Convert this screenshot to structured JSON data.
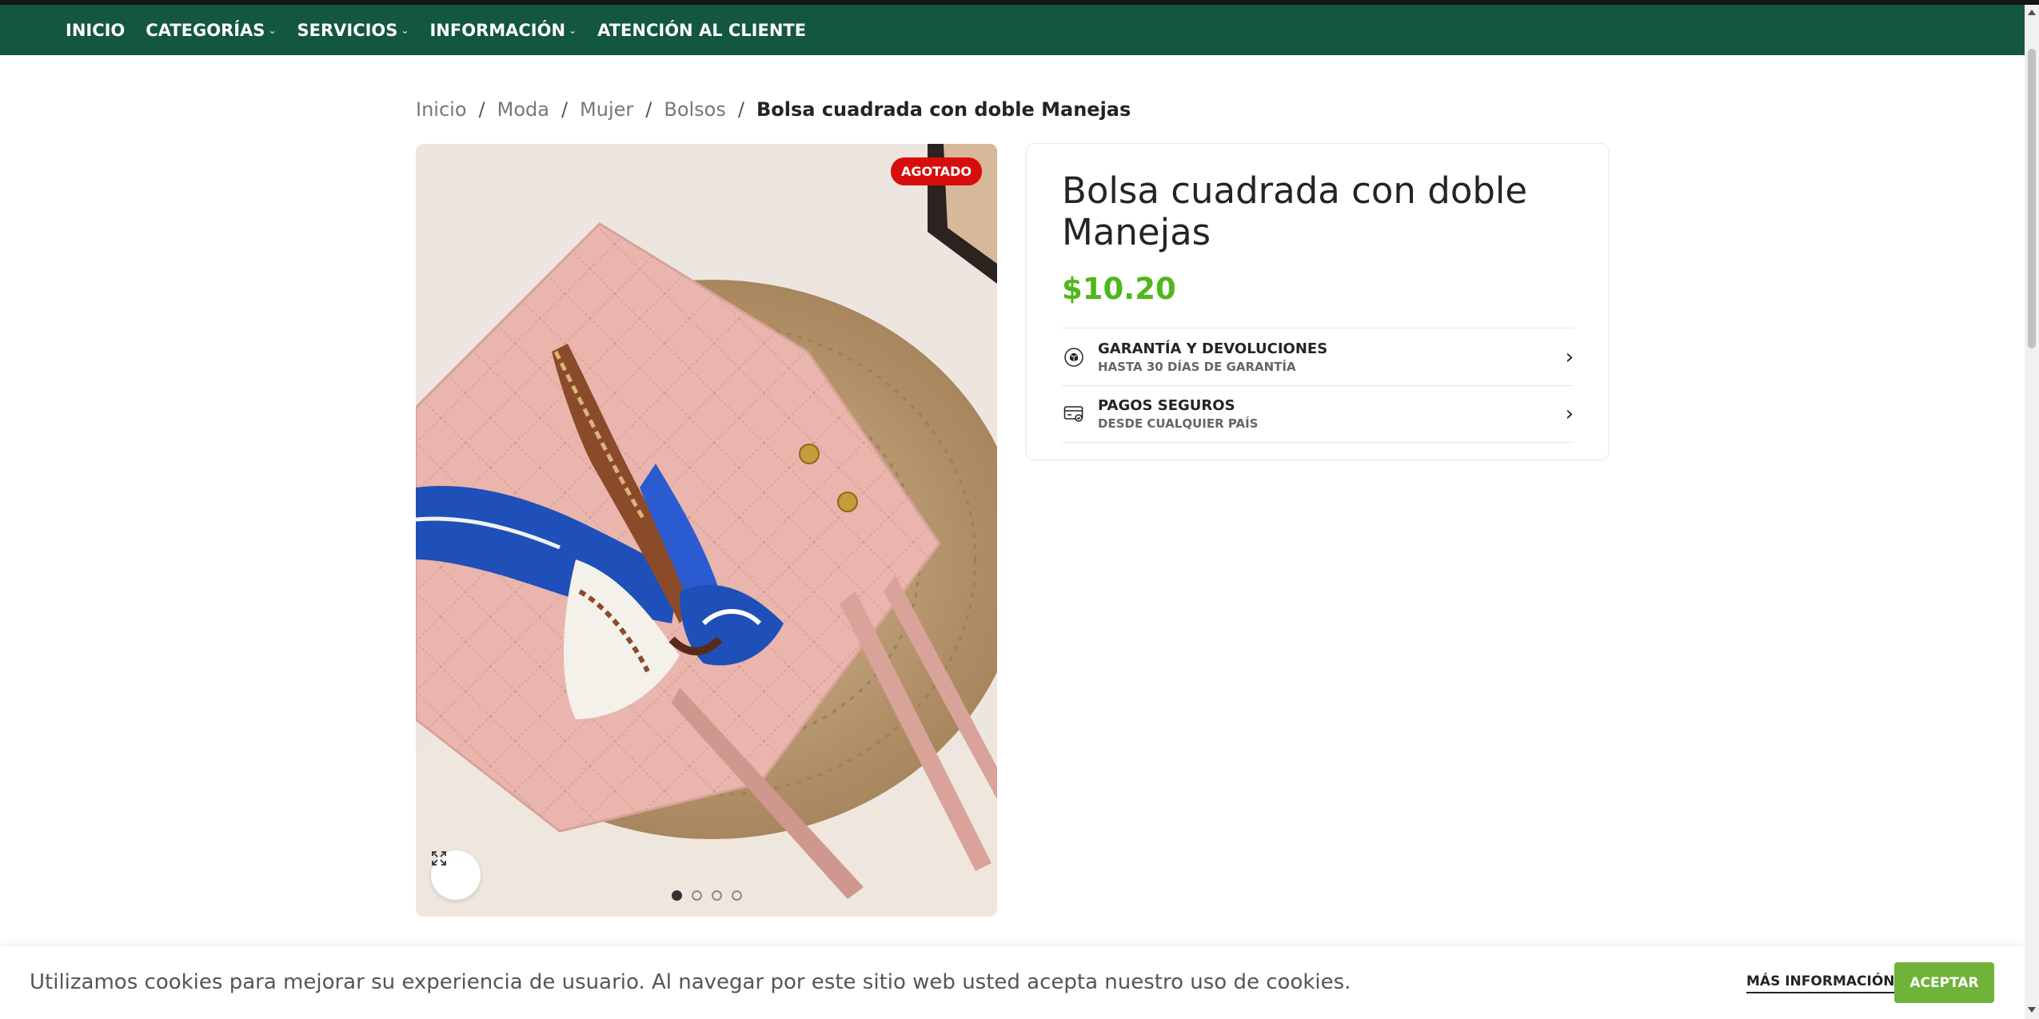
{
  "nav": {
    "items": [
      {
        "label": "INICIO",
        "has_dropdown": false
      },
      {
        "label": "CATEGORÍAS",
        "has_dropdown": true
      },
      {
        "label": "SERVICIOS",
        "has_dropdown": true
      },
      {
        "label": "INFORMACIÓN",
        "has_dropdown": true
      },
      {
        "label": "ATENCIÓN AL CLIENTE",
        "has_dropdown": false
      }
    ],
    "dropdown_icon": "chevron-down-icon"
  },
  "breadcrumb": {
    "items": [
      "Inicio",
      "Moda",
      "Mujer",
      "Bolsos"
    ],
    "current": "Bolsa cuadrada con doble Manejas",
    "separator": "/"
  },
  "product": {
    "title": "Bolsa cuadrada con doble Manejas",
    "price": "$10.20",
    "badge": "AGOTADO",
    "gallery": {
      "image_count": 4,
      "active_index": 0,
      "zoom_icon": "expand-icon",
      "image_subject": "pink quilted square handbag with blue patterned scarf on a woven straw mat"
    }
  },
  "features": [
    {
      "icon": "box-icon",
      "title": "GARANTÍA Y DEVOLUCIONES",
      "subtitle": "HASTA 30 DÍAS DE GARANTÍA"
    },
    {
      "icon": "credit-card-icon",
      "title": "PAGOS SEGUROS",
      "subtitle": "DESDE CUALQUIER PAÍS"
    }
  ],
  "cookie": {
    "text": "Utilizamos cookies para mejorar su experiencia de usuario. Al navegar por este sitio web usted acepta nuestro uso de cookies.",
    "more_label": "MÁS INFORMACIÓN",
    "accept_label": "ACEPTAR"
  },
  "colors": {
    "nav_bg": "#13573e",
    "price": "#4fb71b",
    "badge": "#d80d0d",
    "accept_button": "#6fb33a"
  }
}
